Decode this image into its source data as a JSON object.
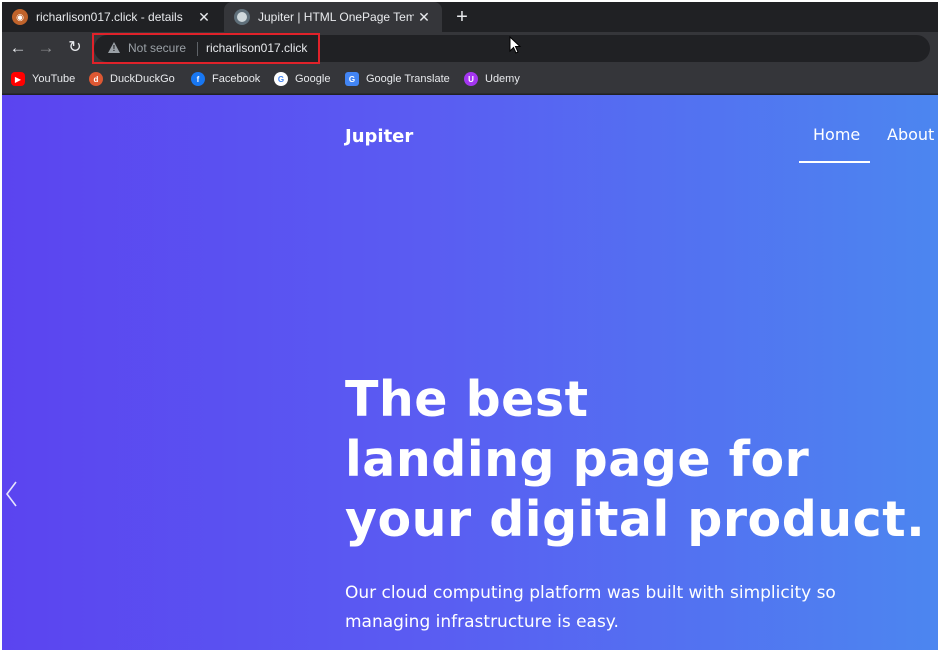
{
  "browser": {
    "tabs": [
      {
        "title": "richarlison017.click - details",
        "close": "✕"
      },
      {
        "title": "Jupiter | HTML OnePage Template",
        "close": "✕"
      }
    ],
    "new_tab": "+",
    "nav": {
      "back": "←",
      "forward": "→",
      "reload": "↻"
    },
    "security_label": "Not secure",
    "url": "richarlison017.click",
    "bookmarks": [
      {
        "label": "YouTube",
        "icon": "youtube-icon"
      },
      {
        "label": "DuckDuckGo",
        "icon": "duckduckgo-icon"
      },
      {
        "label": "Facebook",
        "icon": "facebook-icon"
      },
      {
        "label": "Google",
        "icon": "google-icon"
      },
      {
        "label": "Google Translate",
        "icon": "google-translate-icon"
      },
      {
        "label": "Udemy",
        "icon": "udemy-icon"
      }
    ]
  },
  "site": {
    "brand": "Jupiter",
    "nav": [
      {
        "label": "Home",
        "active": true
      },
      {
        "label": "About",
        "active": false
      }
    ],
    "hero": {
      "title_lines": [
        "The best",
        "landing page for",
        "your digital product."
      ],
      "subtitle": "Our cloud computing platform was built with simplicity so managing infrastructure is easy."
    },
    "colors": {
      "gradient_start": "#5b44f0",
      "gradient_end": "#4c86f0",
      "highlight_box": "#e0222a"
    }
  }
}
